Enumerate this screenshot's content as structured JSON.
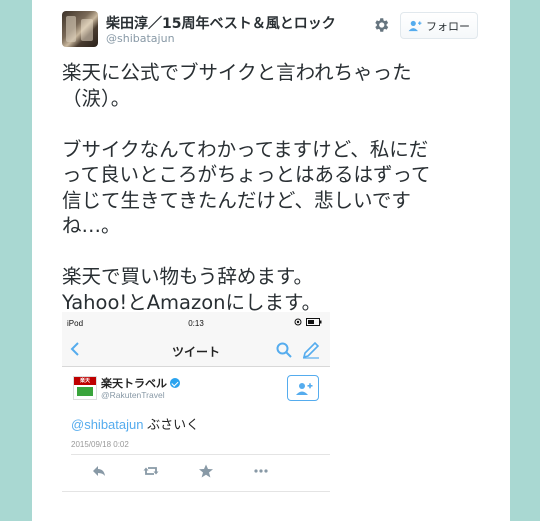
{
  "tweet": {
    "display_name": "柴田淳／15周年ベスト＆風とロック",
    "screen_name": "@shibatajun",
    "follow_label": "フォロー",
    "lines": [
      "楽天に公式でブサイクと言われちゃった",
      "（涙）。",
      "",
      "ブサイクなんてわかってますけど、私にだ",
      "って良いところがちょっとはあるはずって",
      "信じて生きてきたんだけど、悲しいです",
      "ね…。",
      "",
      "楽天で買い物もう辞めます。",
      "Yahoo!とAmazonにします。"
    ]
  },
  "embedded": {
    "status_left": "iPod",
    "status_time": "0:13",
    "nav_title": "ツイート",
    "account_name": "楽天トラベル",
    "account_handle": "@RakutenTravel",
    "logo_text": "楽天",
    "mention": "@shibatajun",
    "message": " ぶさいく",
    "date": "2015/09/18 0:02"
  },
  "colors": {
    "background": "#a9d8d2",
    "text": "#292f33",
    "muted": "#8899a6",
    "link": "#55acee",
    "rakuten_red": "#bf0000"
  },
  "icons": [
    "gear-icon",
    "follow-person-icon",
    "back-chevron-icon",
    "search-icon",
    "compose-icon",
    "verified-icon",
    "reply-icon",
    "retweet-icon",
    "favorite-icon",
    "more-icon"
  ]
}
